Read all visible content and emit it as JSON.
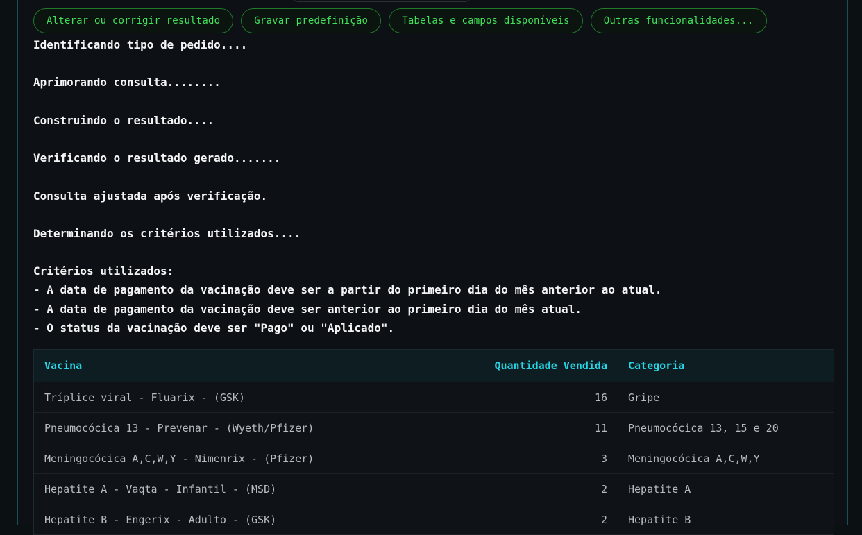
{
  "actions": [
    {
      "label": "Alterar ou corrigir resultado"
    },
    {
      "label": "Gravar predefinição"
    },
    {
      "label": "Tabelas e campos disponíveis"
    },
    {
      "label": "Outras funcionalidades..."
    }
  ],
  "log": [
    "Identificando tipo de pedido....",
    "",
    "Aprimorando consulta........",
    "",
    "Construindo o resultado....",
    "",
    "Verificando o resultado gerado.......",
    "",
    "Consulta ajustada após verificação.",
    "",
    "Determinando os critérios utilizados....",
    "",
    "Critérios utilizados:",
    "- A data de pagamento da vacinação deve ser a partir do primeiro dia do mês anterior ao atual.",
    "- A data de pagamento da vacinação deve ser anterior ao primeiro dia do mês atual.",
    "- O status da vacinação deve ser \"Pago\" ou \"Aplicado\"."
  ],
  "table": {
    "headers": [
      "Vacina",
      "Quantidade Vendida",
      "Categoria"
    ],
    "rows": [
      [
        "Tríplice viral - Fluarix - (GSK)",
        "16",
        "Gripe"
      ],
      [
        "Pneumocócica 13 - Prevenar - (Wyeth/Pfizer)",
        "11",
        "Pneumocócica 13, 15 e 20"
      ],
      [
        "Meningocócica A,C,W,Y - Nimenrix - (Pfizer)",
        "3",
        "Meningocócica A,C,W,Y"
      ],
      [
        "Hepatite A - Vaqta - Infantil - (MSD)",
        "2",
        "Hepatite A"
      ],
      [
        "Hepatite B - Engerix - Adulto - (GSK)",
        "2",
        "Hepatite B"
      ]
    ]
  }
}
